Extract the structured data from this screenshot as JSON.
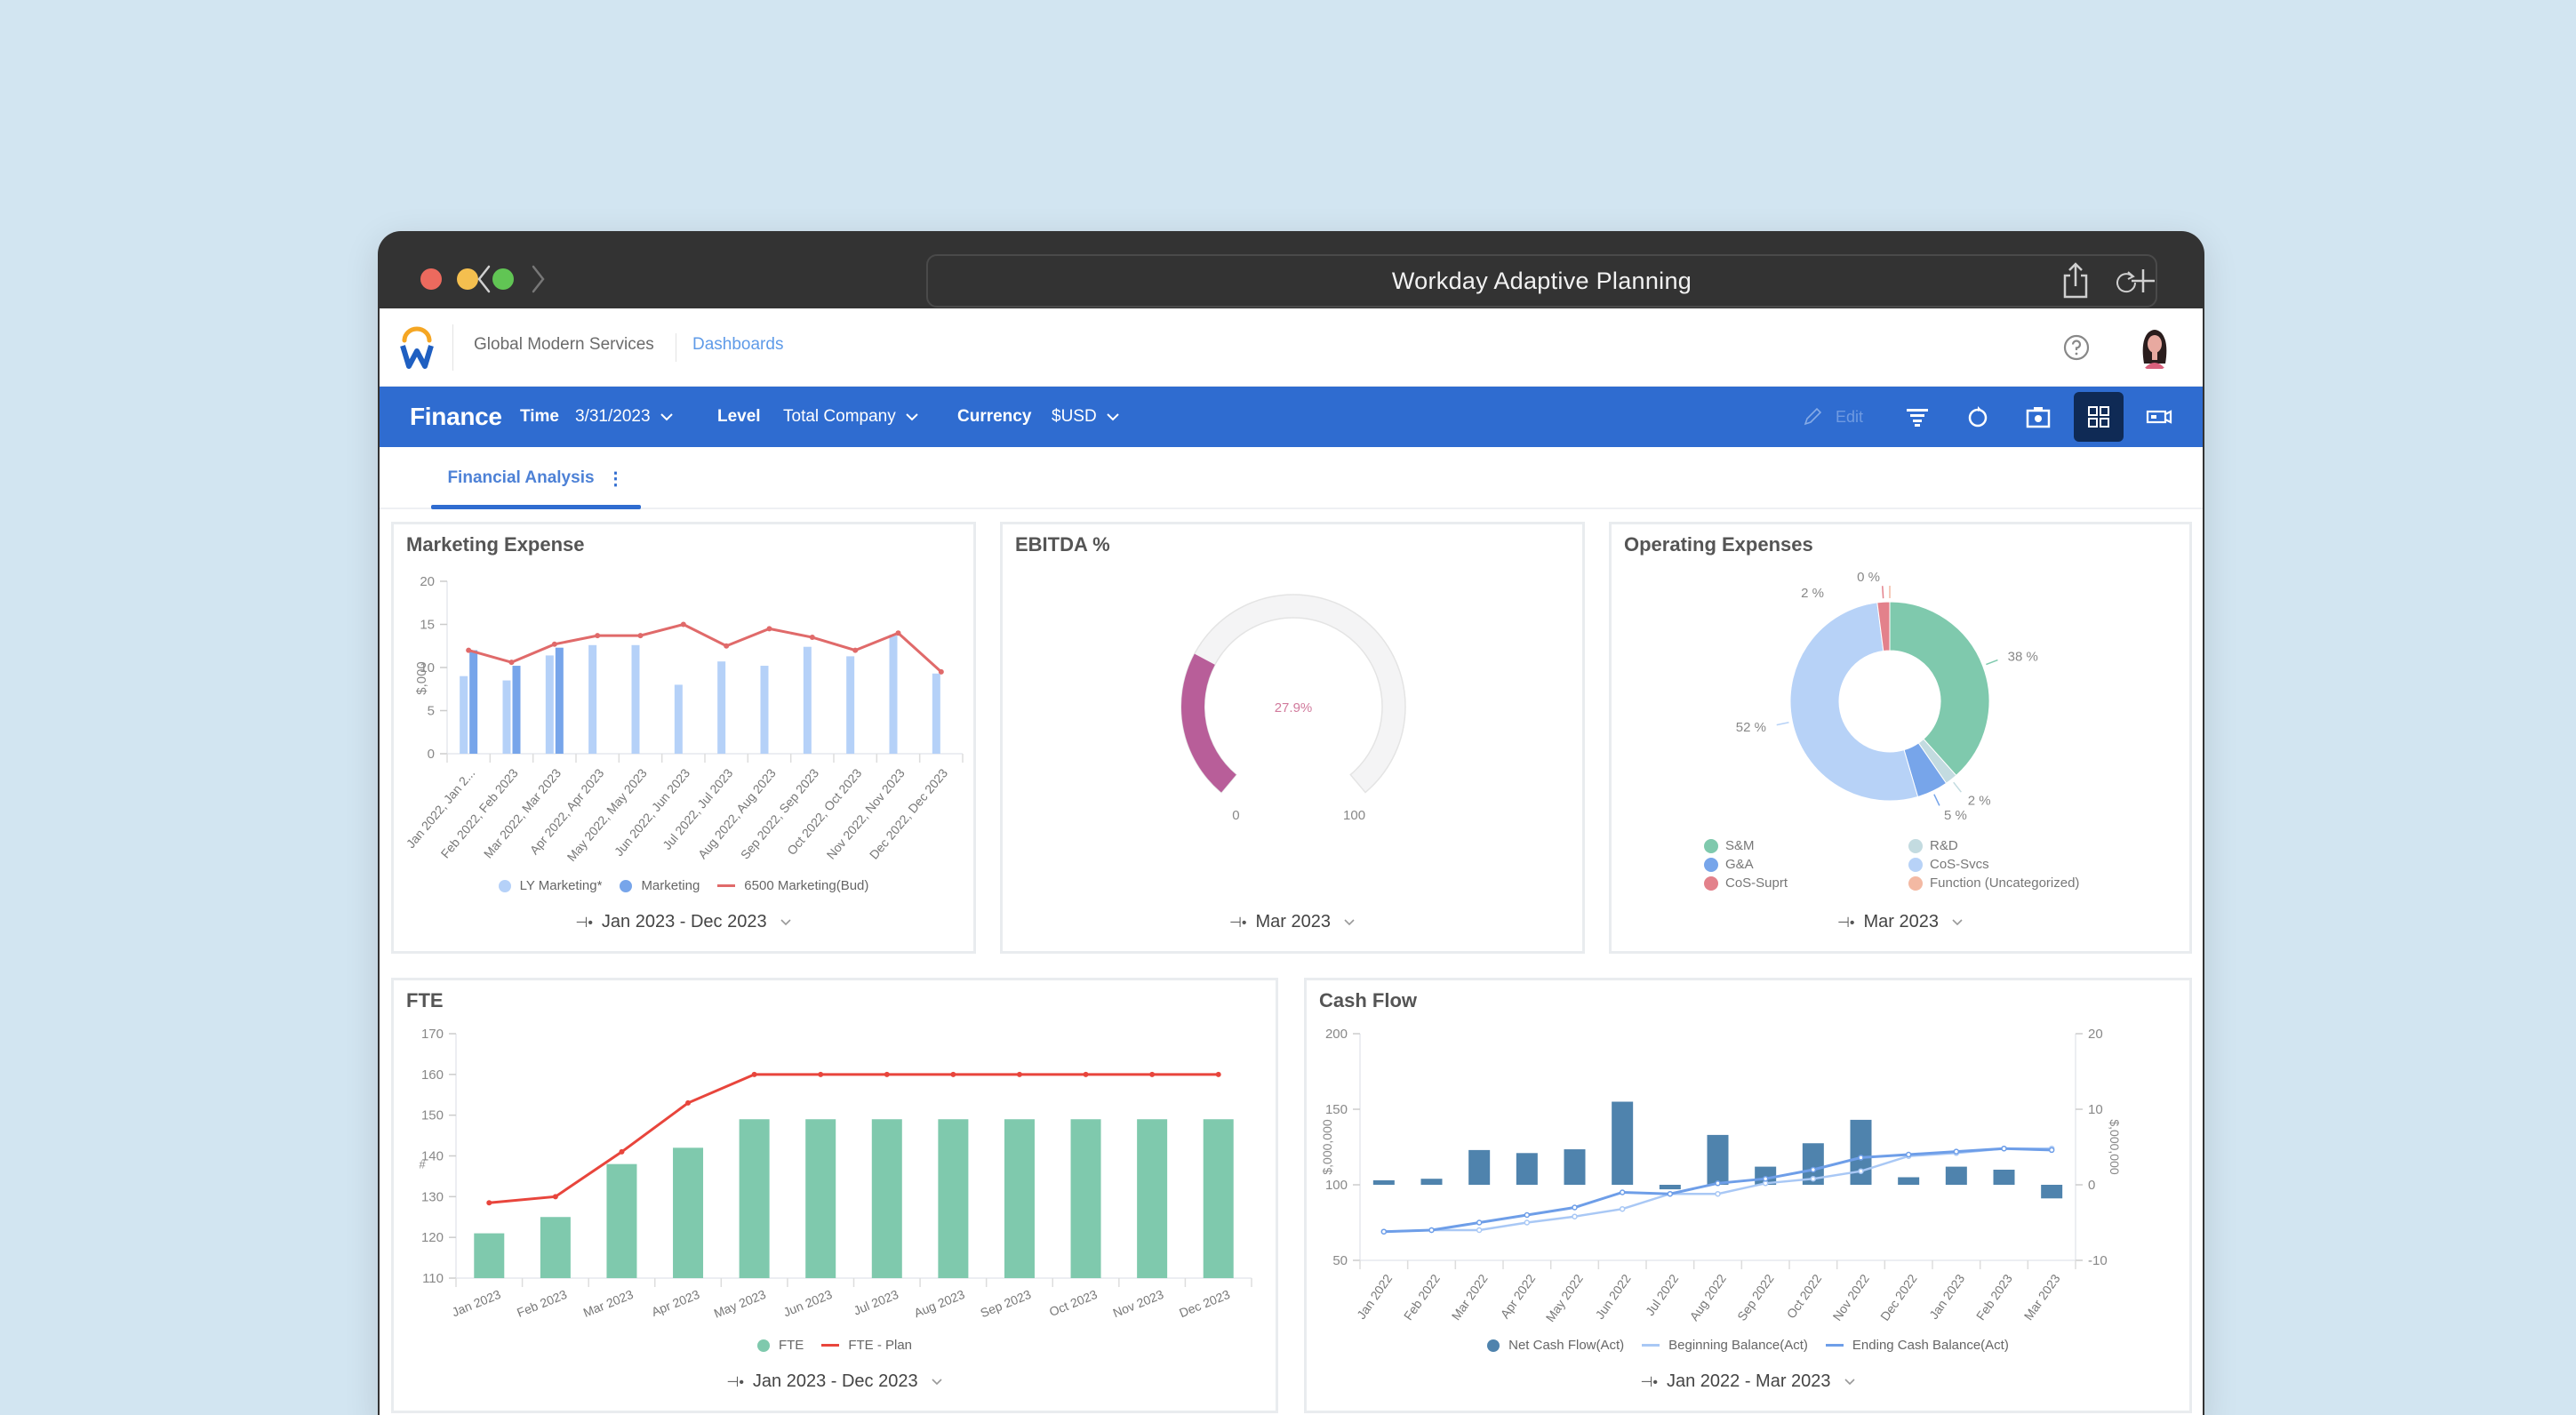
{
  "browser": {
    "url_title": "Workday Adaptive Planning"
  },
  "app": {
    "org": "Global Modern Services",
    "breadcrumb": "Dashboards"
  },
  "toolbar": {
    "title": "Finance",
    "time_label": "Time",
    "time_value": "3/31/2023",
    "level_label": "Level",
    "level_value": "Total Company",
    "currency_label": "Currency",
    "currency_value": "$USD",
    "edit_label": "Edit",
    "accent": "#2f6cd0"
  },
  "tabs": [
    {
      "label": "Financial Analysis",
      "active": true
    }
  ],
  "cards": {
    "marketing": {
      "title": "Marketing Expense",
      "period": "Jan 2023 - Dec 2023"
    },
    "ebitda": {
      "title": "EBITDA %",
      "period": "Mar 2023"
    },
    "opex": {
      "title": "Operating Expenses",
      "period": "Mar 2023"
    },
    "fte": {
      "title": "FTE",
      "period": "Jan 2023 - Dec 2023"
    },
    "cashflow": {
      "title": "Cash Flow",
      "period": "Jan 2022 - Mar 2023"
    }
  },
  "chart_data": [
    {
      "id": "marketing",
      "type": "bar",
      "title": "Marketing Expense",
      "ylabel": "$,000",
      "ylim": [
        0,
        20
      ],
      "yticks": [
        0,
        5,
        10,
        15,
        20
      ],
      "categories": [
        "Jan 2022, Jan 2...",
        "Feb 2022, Feb 2023",
        "Mar 2022, Mar 2023",
        "Apr 2022, Apr 2023",
        "May 2022, May 2023",
        "Jun 2022, Jun 2023",
        "Jul 2022, Jul 2023",
        "Aug 2022, Aug 2023",
        "Sep 2022, Sep 2023",
        "Oct 2022, Oct 2023",
        "Nov 2022, Nov 2023",
        "Dec 2022, Dec 2023"
      ],
      "series": [
        {
          "name": "LY Marketing*",
          "kind": "bar",
          "color": "#b5d1f8",
          "values": [
            9.0,
            8.5,
            11.4,
            12.6,
            12.6,
            8.0,
            10.7,
            10.2,
            12.4,
            11.3,
            13.8,
            9.3
          ]
        },
        {
          "name": "Marketing",
          "kind": "bar",
          "color": "#77a5ea",
          "values": [
            12.0,
            10.2,
            12.3,
            null,
            null,
            null,
            null,
            null,
            null,
            null,
            null,
            null
          ]
        },
        {
          "name": "6500 Marketing(Bud)",
          "kind": "line",
          "color": "#e06a6a",
          "values": [
            12.0,
            10.6,
            12.7,
            13.7,
            13.7,
            15.0,
            12.5,
            14.5,
            13.5,
            12.0,
            14.0,
            9.5
          ]
        }
      ],
      "legend": [
        "LY Marketing*",
        "Marketing",
        "6500 Marketing(Bud)"
      ]
    },
    {
      "id": "ebitda",
      "type": "gauge",
      "title": "EBITDA %",
      "value": 27.9,
      "value_label": "27.9%",
      "min": 0,
      "max": 100,
      "min_label": "0",
      "max_label": "100",
      "color": "#b85e99"
    },
    {
      "id": "opex",
      "type": "pie",
      "title": "Operating Expenses",
      "donut": true,
      "slices": [
        {
          "name": "S&M",
          "value": 38,
          "label": "38 %",
          "color": "#7fc9ad"
        },
        {
          "name": "R&D",
          "value": 2,
          "label": "2 %",
          "color": "#c3dbe0"
        },
        {
          "name": "G&A",
          "value": 5,
          "label": "5 %",
          "color": "#77a5ea"
        },
        {
          "name": "CoS-Svcs",
          "value": 52,
          "label": "52 %",
          "color": "#b7d2f7"
        },
        {
          "name": "CoS-Suprt",
          "value": 2,
          "label": "2 %",
          "color": "#e3818b"
        },
        {
          "name": "Function (Uncategorized)",
          "value": 0,
          "label": "0 %",
          "color": "#f3b9a3"
        }
      ],
      "legend": [
        "S&M",
        "R&D",
        "G&A",
        "CoS-Svcs",
        "CoS-Suprt",
        "Function (Uncategorized)"
      ]
    },
    {
      "id": "fte",
      "type": "bar",
      "title": "FTE",
      "ylabel": "#",
      "ylim": [
        110,
        170
      ],
      "yticks": [
        110,
        120,
        130,
        140,
        150,
        160,
        170
      ],
      "categories": [
        "Jan 2023",
        "Feb 2023",
        "Mar 2023",
        "Apr 2023",
        "May 2023",
        "Jun 2023",
        "Jul 2023",
        "Aug 2023",
        "Sep 2023",
        "Oct 2023",
        "Nov 2023",
        "Dec 2023"
      ],
      "series": [
        {
          "name": "FTE",
          "kind": "bar",
          "color": "#7fc9ad",
          "values": [
            121,
            125,
            138,
            142,
            149,
            149,
            149,
            149,
            149,
            149,
            149,
            149
          ]
        },
        {
          "name": "FTE - Plan",
          "kind": "line",
          "color": "#e8453c",
          "values": [
            128.5,
            130,
            141,
            153,
            160,
            160,
            160,
            160,
            160,
            160,
            160,
            160
          ]
        }
      ],
      "legend": [
        "FTE",
        "FTE - Plan"
      ]
    },
    {
      "id": "cashflow",
      "type": "bar",
      "title": "Cash Flow",
      "ylabel": "$,000,000",
      "ylabel_right": "$,000,000",
      "ylim": [
        50,
        200
      ],
      "yticks": [
        50,
        100,
        150,
        200
      ],
      "ylim_right": [
        -10,
        20
      ],
      "yticks_right": [
        -10,
        0,
        10,
        20
      ],
      "categories": [
        "Jan 2022",
        "Feb 2022",
        "Mar 2022",
        "Apr 2022",
        "May 2022",
        "Jun 2022",
        "Jul 2022",
        "Aug 2022",
        "Sep 2022",
        "Oct 2022",
        "Nov 2022",
        "Dec 2022",
        "Jan 2023",
        "Feb 2023",
        "Mar 2023"
      ],
      "series": [
        {
          "name": "Net Cash Flow(Act)",
          "kind": "bar",
          "axis": "right",
          "color": "#4f83ad",
          "values": [
            0.6,
            0.8,
            4.6,
            4.2,
            4.7,
            11.0,
            -0.6,
            6.6,
            2.4,
            5.5,
            8.6,
            1.0,
            2.4,
            2.0,
            -1.8
          ]
        },
        {
          "name": "Beginning Balance(Act)",
          "kind": "line",
          "axis": "left",
          "color": "#a9c8f5",
          "values": [
            69,
            70,
            70,
            75,
            79,
            84,
            94,
            94,
            101,
            104,
            109,
            119,
            121,
            124,
            124
          ]
        },
        {
          "name": "Ending Cash Balance(Act)",
          "kind": "line",
          "axis": "left",
          "color": "#6e9ee8",
          "values": [
            69,
            70,
            75,
            80,
            85,
            95,
            94,
            101,
            104,
            110,
            118,
            120,
            122,
            124,
            123
          ]
        }
      ],
      "legend": [
        "Net Cash Flow(Act)",
        "Beginning Balance(Act)",
        "Ending Cash Balance(Act)"
      ]
    }
  ]
}
